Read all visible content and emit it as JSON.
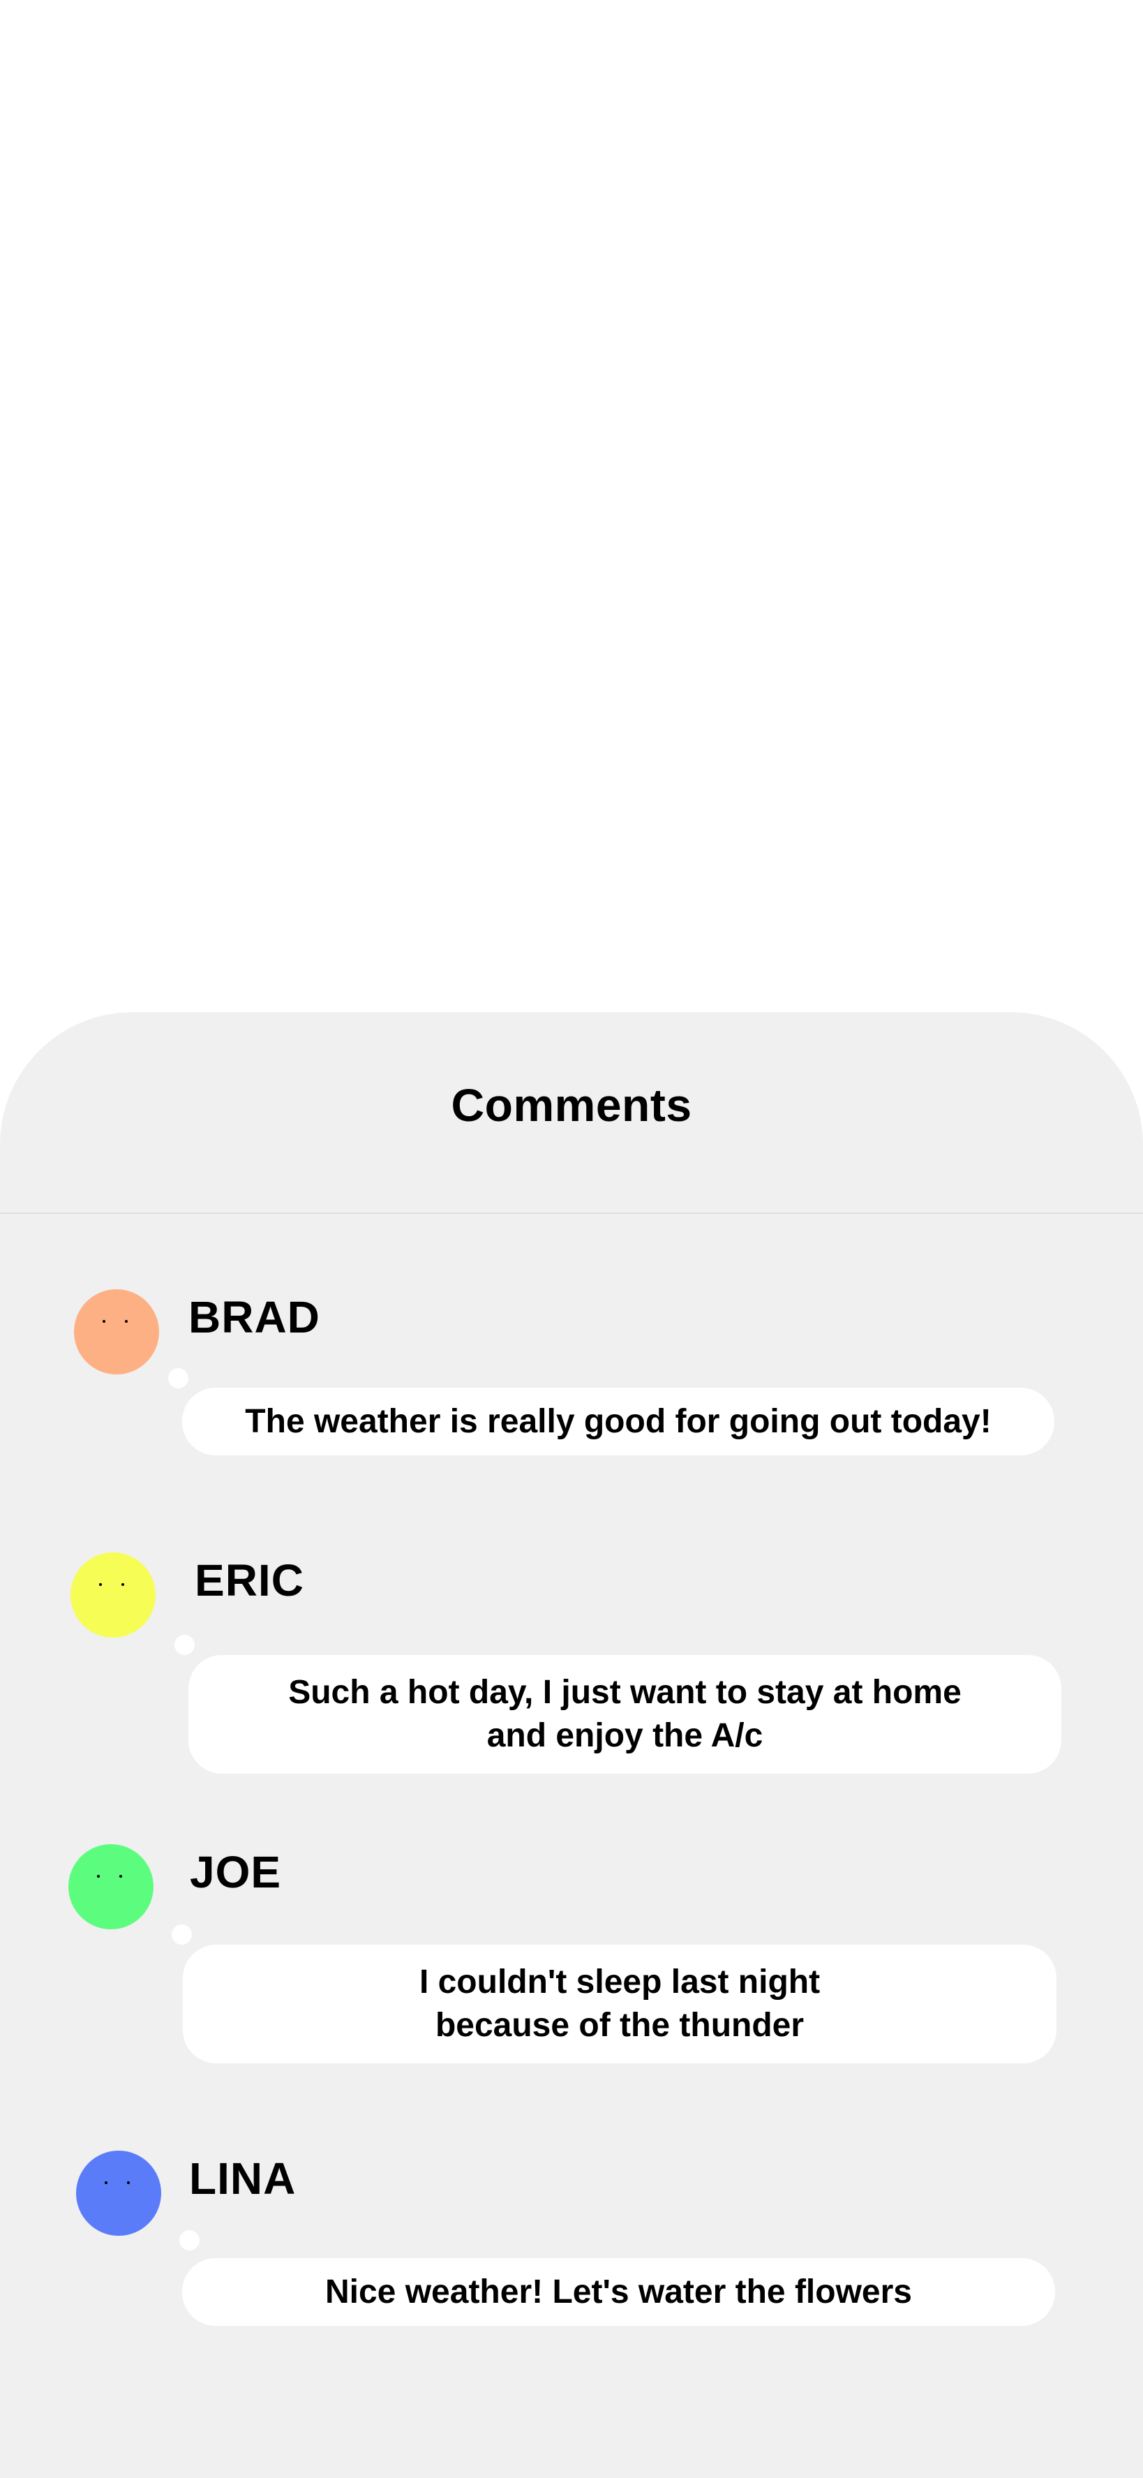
{
  "sheet": {
    "title": "Comments"
  },
  "comments": [
    {
      "name": "BRAD",
      "avatar_color": "#fdb083",
      "text": "The weather is really good for going out today!"
    },
    {
      "name": "ERIC",
      "avatar_color": "#f6fd55",
      "text": "Such a hot day, I just want to stay at home\nand enjoy the A/c"
    },
    {
      "name": "JOE",
      "avatar_color": "#5cfd7e",
      "text": "I couldn't sleep last night\n because of the thunder"
    },
    {
      "name": "LINA",
      "avatar_color": "#5b7cf9",
      "text": "Nice weather! Let's water the flowers"
    }
  ]
}
